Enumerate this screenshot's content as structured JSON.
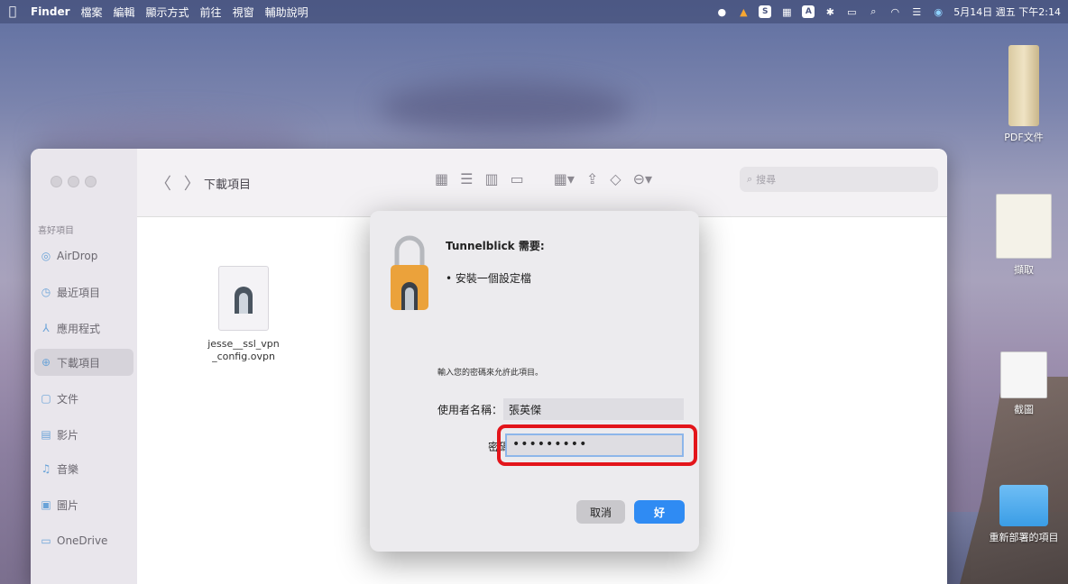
{
  "menubar": {
    "apple_icon": "apple-icon",
    "items": [
      {
        "label": "Finder",
        "bold": true
      },
      {
        "label": "檔案"
      },
      {
        "label": "編輯"
      },
      {
        "label": "顯示方式"
      },
      {
        "label": "前往"
      },
      {
        "label": "視窗"
      },
      {
        "label": "輔助說明"
      }
    ],
    "status_icons": [
      "messages-icon",
      "vlc-icon",
      "s-icon",
      "grid-icon",
      "a-icon",
      "bluetooth-icon",
      "battery-icon",
      "search-icon",
      "wifi-icon",
      "control-center-icon",
      "siri-icon"
    ],
    "clock": "5月14日 週五 下午2:14"
  },
  "desktop": {
    "icons": [
      {
        "label": "PDF文件"
      },
      {
        "label": "擷取"
      },
      {
        "label": "截圖"
      },
      {
        "label": "重新部署的項目"
      }
    ]
  },
  "finder": {
    "title": "下載項目",
    "search_placeholder": "搜尋",
    "sidebar_heading": "喜好項目",
    "sidebar": [
      {
        "label": "AirDrop",
        "icon": "airdrop-icon"
      },
      {
        "label": "最近項目",
        "icon": "clock-icon"
      },
      {
        "label": "應用程式",
        "icon": "apps-icon"
      },
      {
        "label": "下載項目",
        "icon": "download-icon",
        "selected": true
      },
      {
        "label": "文件",
        "icon": "document-icon"
      },
      {
        "label": "影片",
        "icon": "movie-icon"
      },
      {
        "label": "音樂",
        "icon": "music-icon"
      },
      {
        "label": "圖片",
        "icon": "picture-icon"
      },
      {
        "label": "OneDrive",
        "icon": "folder-icon"
      }
    ],
    "file": {
      "name": "jesse__ssl_vpn_config.ovpn"
    }
  },
  "dialog": {
    "title": "Tunnelblick 需要:",
    "bullet": "• 安裝一個設定檔",
    "prompt": "輸入您的密碼來允許此項目。",
    "username_label": "使用者名稱：",
    "username_value": "張英傑",
    "password_label": "密碼",
    "password_value": "•••••••••",
    "cancel_label": "取消",
    "ok_label": "好"
  },
  "colors": {
    "highlight": "#e3151b",
    "ok_button": "#2f8bf3"
  }
}
